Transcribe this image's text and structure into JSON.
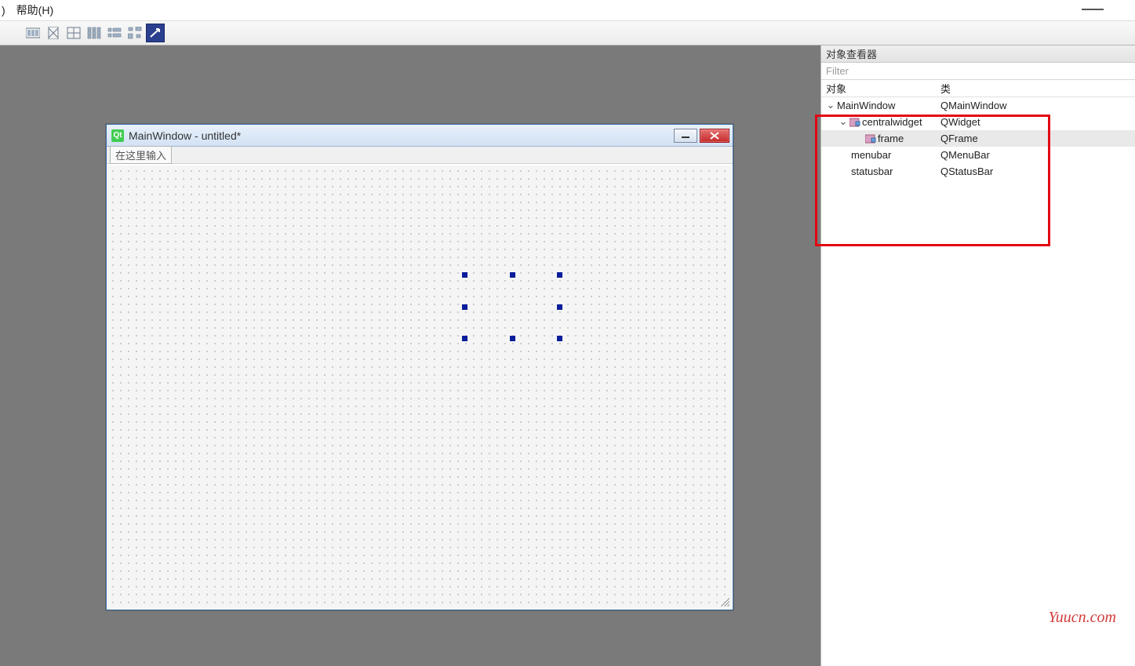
{
  "menubar": {
    "partial_item": ")",
    "help": "帮助(H)"
  },
  "design_window": {
    "title": "MainWindow - untitled*",
    "menu_placeholder": "在这里输入"
  },
  "inspector": {
    "title": "对象查看器",
    "filter_placeholder": "Filter",
    "columns": {
      "object": "对象",
      "class": "类"
    },
    "rows": [
      {
        "name": "MainWindow",
        "class": "QMainWindow",
        "indent": 0,
        "expand": true,
        "icon": null,
        "selected": false
      },
      {
        "name": "centralwidget",
        "class": "QWidget",
        "indent": 1,
        "expand": true,
        "icon": "widget",
        "selected": false
      },
      {
        "name": "frame",
        "class": "QFrame",
        "indent": 2,
        "expand": false,
        "icon": "widget",
        "selected": true
      },
      {
        "name": "menubar",
        "class": "QMenuBar",
        "indent": 1,
        "expand": false,
        "icon": null,
        "selected": false,
        "noTwist": true
      },
      {
        "name": "statusbar",
        "class": "QStatusBar",
        "indent": 1,
        "expand": false,
        "icon": null,
        "selected": false,
        "noTwist": true
      }
    ]
  },
  "watermark": "Yuucn.com"
}
